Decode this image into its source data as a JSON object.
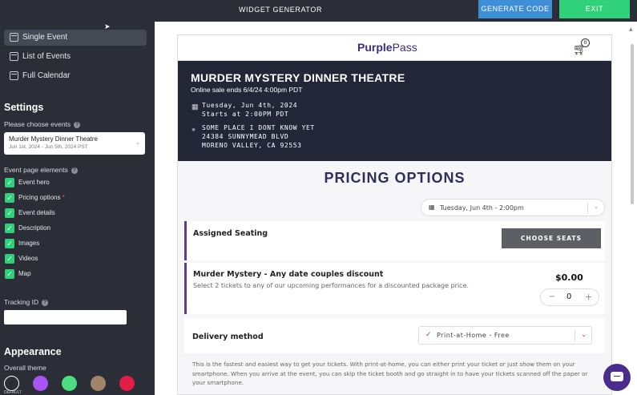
{
  "topbar": {
    "title": "WIDGET GENERATOR",
    "generate_label": "GENERATE CODE",
    "exit_label": "EXIT"
  },
  "sidebar": {
    "nav": [
      {
        "label": "Single Event",
        "active": true
      },
      {
        "label": "List of Events",
        "active": false
      },
      {
        "label": "Full Calendar",
        "active": false
      }
    ],
    "settings_heading": "Settings",
    "choose_events_label": "Please choose events",
    "selected_event": {
      "name": "Murder Mystery Dinner Theatre",
      "dates": "Jun 1st, 2024 - Jun 5th, 2024 PST"
    },
    "elements_label": "Event page elements",
    "elements": [
      {
        "label": "Event hero",
        "checked": true,
        "required": false
      },
      {
        "label": "Pricing options",
        "checked": true,
        "required": true
      },
      {
        "label": "Event details",
        "checked": true,
        "required": false
      },
      {
        "label": "Description",
        "checked": true,
        "required": false
      },
      {
        "label": "Images",
        "checked": true,
        "required": false
      },
      {
        "label": "Videos",
        "checked": true,
        "required": false
      },
      {
        "label": "Map",
        "checked": true,
        "required": false
      }
    ],
    "required_mark": "*",
    "tracking_label": "Tracking ID",
    "tracking_value": "",
    "appearance_heading": "Appearance",
    "theme_label": "Overall theme",
    "themes": [
      "#ffffff",
      "#a855f7",
      "#4ade80",
      "#a1846a",
      "#e11d48"
    ],
    "default_label": "DEFAULT"
  },
  "widget": {
    "logo_purple": "Purple",
    "logo_pass": "Pass",
    "cart_count": "0",
    "hero": {
      "name": "MURDER MYSTERY DINNER THEATRE",
      "sale": "Online sale ends 6/4/24 4:00pm PDT",
      "date_line1": "Tuesday, Jun 4th, 2024",
      "date_line2": "Starts at 2:00PM PDT",
      "addr_line1": "SOME PLACE I DONT KNOW YET",
      "addr_line2": "24384 SUNNYMEAD BLVD",
      "addr_line3": "MORENO VALLEY, CA 92553"
    },
    "pricing_title": "PRICING OPTIONS",
    "date_select": "Tuesday, Jun 4th - 2:00pm",
    "assigned_seating": "Assigned Seating",
    "choose_seats": "CHOOSE SEATS",
    "ticket": {
      "name": "Murder Mystery - Any date couples discount",
      "desc": "Select 2 tickets to any of our upcoming performances for a discounted package price.",
      "price": "$0.00",
      "quantity": "0"
    },
    "delivery_label": "Delivery method",
    "delivery_value": "Print-at-Home - Free",
    "delivery_text": "This is the fastest and easiest way to get your tickets. With print-at-home, you can either print your ticket or just show them on your smartphone. When you arrive at the event, you can skip the ticket booth and go straight in to have your tickets scanned off the paper or your smartphone."
  },
  "colors": {
    "accent_blue": "#3f8ed8",
    "accent_green": "#2fd27a",
    "hero_bg": "#222637",
    "brand_purple": "#3c2e7a"
  }
}
